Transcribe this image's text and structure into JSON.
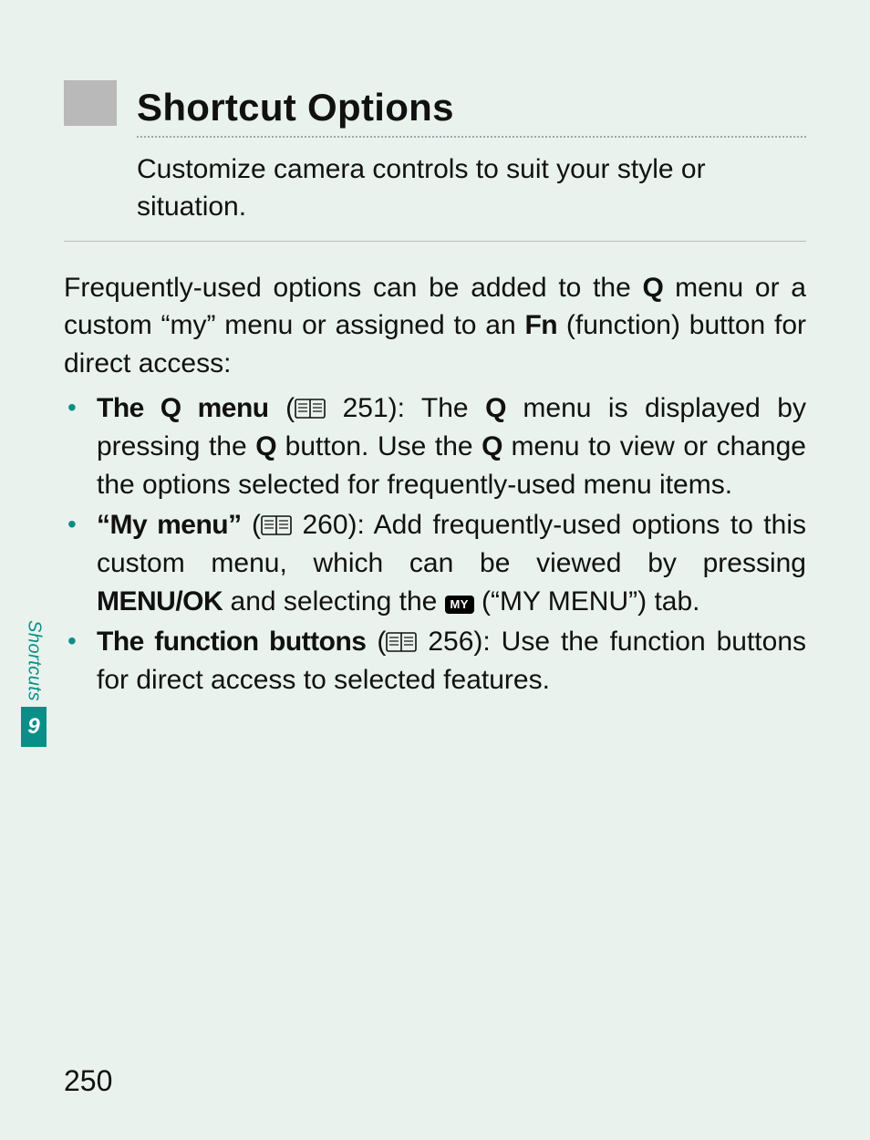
{
  "heading": "Shortcut Options",
  "subtitle": "Customize camera controls to suit your style or situation.",
  "intro": {
    "pre": "Frequently-used options can be added to the ",
    "q1": "Q",
    "mid1": " menu or a custom “my” menu or assigned to an ",
    "fn": "Fn",
    "post": " (function) button for direct access:"
  },
  "bullets": {
    "b1": {
      "label": "The Q menu",
      "page": " 251): The ",
      "q1": "Q",
      "mid": " menu is displayed by pressing the ",
      "q2": "Q",
      "mid2": " button.  Use the ",
      "q3": "Q",
      "post": " menu to view or change the options selected for frequently-used menu items."
    },
    "b2": {
      "label": "“My menu”",
      "page": " 260): Add frequently-used options to this custom menu, which can be viewed by pressing ",
      "menuok": "MENU/OK",
      "post1": " and selecting the ",
      "chip": "MY",
      "post2": " (“MY MENU”) tab."
    },
    "b3": {
      "label": "The function buttons",
      "page": " 256): Use the function buttons for direct access to selected features."
    }
  },
  "side": {
    "label": "Shortcuts",
    "num": "9"
  },
  "page_number": "250",
  "open_paren": " ("
}
